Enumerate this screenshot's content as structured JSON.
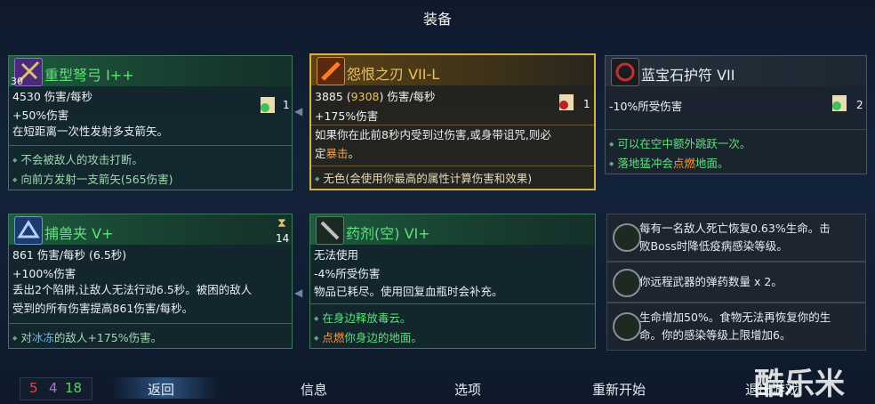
{
  "title": "装备",
  "cards": {
    "crossbow": {
      "name": "重型弩弓 I++",
      "level": "30",
      "stat1": "4530 伤害/每秒",
      "stat2": "+50%伤害",
      "count": "1",
      "desc": "在短距离一次性发射多支箭矢。",
      "b1": "不会被敌人的攻击打断。",
      "b2": "向前方发射一支箭矢(565伤害)"
    },
    "blade": {
      "name": "怨恨之刃 VII-L",
      "stat1a": "3885 (",
      "stat1b": "9308",
      "stat1c": ") 伤害/每秒",
      "stat2": "+175%伤害",
      "count": "1",
      "desc1": "如果你在此前8秒内受到过伤害,或身带诅咒,则必",
      "desc2a": "定",
      "desc2b": "暴击",
      "desc2c": "。",
      "b1": "无色(会使用你最高的属性计算伤害和效果)"
    },
    "amulet": {
      "name": "蓝宝石护符 VII",
      "stat1": "-10%所受伤害",
      "count": "2",
      "b1": "可以在空中额外跳跃一次。",
      "b2a": "落地猛冲会",
      "b2b": "点燃",
      "b2c": "地面。"
    },
    "trap": {
      "name": "捕兽夹 V+",
      "count": "14",
      "stat1": "861 伤害/每秒 (6.5秒)",
      "stat2": "+100%伤害",
      "desc1": "丢出2个陷阱,让敌人无法行动6.5秒。被困的敌人",
      "desc2": "受到的所有伤害提高861伤害/每秒。",
      "b1a": "对",
      "b1b": "冰冻",
      "b1c": "的敌人+175%伤害。"
    },
    "potion": {
      "name": "药剂(空) VI+",
      "stat1": "无法使用",
      "stat2": "-4%所受伤害",
      "desc": "物品已耗尽。使用回复血瓶时会补充。",
      "b1a": "在身边释放",
      "b1b": "毒云",
      "b1c": "。",
      "b2a": "点燃",
      "b2b": "你身边的地面。"
    }
  },
  "mutations": [
    {
      "line1": "每有一名敌人死亡恢复0.63%生命。击",
      "line2": "败Boss时降低疫病感染等级。"
    },
    {
      "line1": "你远程武器的弹药数量 x 2。",
      "line2": ""
    },
    {
      "line1": "生命增加50%。食物无法再恢复你的生",
      "line2": "命。你的感染等级上限增加6。"
    }
  ],
  "stats": {
    "red": "5",
    "purple": "4",
    "green": "18"
  },
  "nav": {
    "back": "返回",
    "info": "信息",
    "options": "选项",
    "restart": "重新开始",
    "quit": "退出游戏"
  },
  "watermark": "酷乐米"
}
